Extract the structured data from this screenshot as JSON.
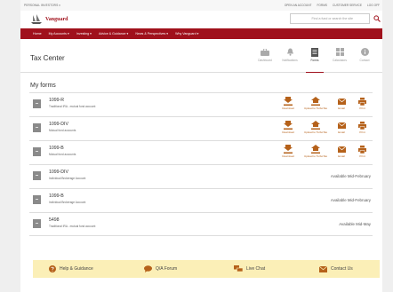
{
  "utility": {
    "personal": "PERSONAL INVESTORS ▾",
    "links": [
      "OPEN AN ACCOUNT",
      "FORMS",
      "CUSTOMER SERVICE",
      "LOG OFF"
    ]
  },
  "brand": {
    "name": "Vanguard"
  },
  "search": {
    "placeholder": "Find a fund or search the site"
  },
  "nav": [
    {
      "label": "Home"
    },
    {
      "label": "My Accounts ▾"
    },
    {
      "label": "Investing ▾"
    },
    {
      "label": "Advice & Guidance ▾"
    },
    {
      "label": "News & Perspectives ▾"
    },
    {
      "label": "Why Vanguard ▾"
    }
  ],
  "page": {
    "title": "Tax Center",
    "section": "My forms"
  },
  "tabs": [
    {
      "label": "Dashboard",
      "icon": "briefcase-icon",
      "active": false
    },
    {
      "label": "Notifications",
      "icon": "bell-icon",
      "active": false
    },
    {
      "label": "Forms",
      "icon": "document-icon",
      "active": true
    },
    {
      "label": "Calculators",
      "icon": "calculator-icon",
      "active": false
    },
    {
      "label": "Contact",
      "icon": "info-icon",
      "active": false
    }
  ],
  "actions": {
    "download": "Download",
    "upload": "Upload to TurboTax",
    "email": "Email",
    "print": "Print"
  },
  "forms": [
    {
      "name": "1099-R",
      "sub": "Traditional IRA - mutual fund account",
      "status": ""
    },
    {
      "name": "1099-DIV",
      "sub": "Mutual fund accounts",
      "status": ""
    },
    {
      "name": "1099-B",
      "sub": "Mutual fund accounts",
      "status": ""
    },
    {
      "name": "1099-DIV",
      "sub": "Individual Brokerage Account",
      "status": "Available Mid-February"
    },
    {
      "name": "1099-B",
      "sub": "Individual Brokerage Account",
      "status": "Available Mid-February"
    },
    {
      "name": "5498",
      "sub": "Traditional IRA - mutual fund account",
      "status": "Available Mid-May"
    }
  ],
  "help": [
    {
      "label": "Help & Guidance",
      "icon": "question-icon"
    },
    {
      "label": "Q/A Forum",
      "icon": "chat-bubble-icon"
    },
    {
      "label": "Live Chat",
      "icon": "live-chat-icon"
    },
    {
      "label": "Contact Us",
      "icon": "mail-icon"
    }
  ],
  "colors": {
    "brand_red": "#a0111c",
    "action_orange": "#b5611a",
    "help_bar": "#fbefb7"
  }
}
